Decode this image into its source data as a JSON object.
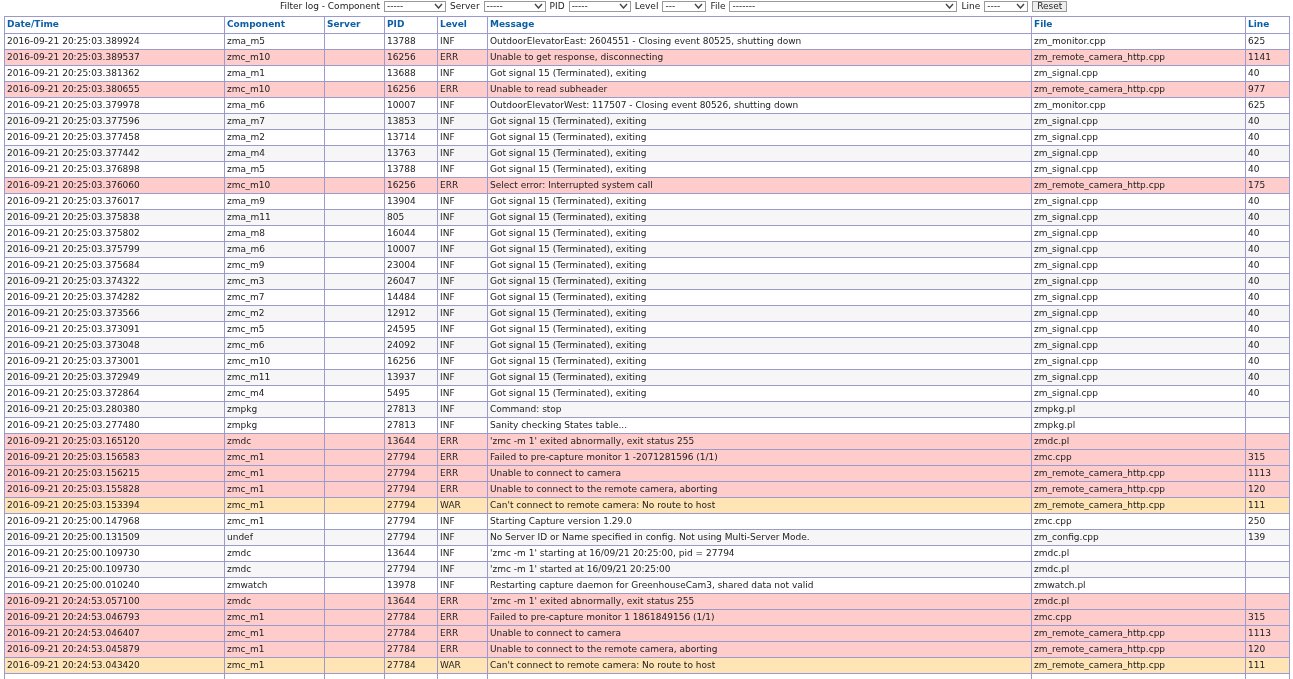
{
  "filters": [
    {
      "label": "Filter log - Component",
      "value": "-----"
    },
    {
      "label": "Server",
      "value": "-----"
    },
    {
      "label": "PID",
      "value": "-----"
    },
    {
      "label": "Level",
      "value": "---"
    },
    {
      "label": "File",
      "value": "-------"
    },
    {
      "label": "Line",
      "value": "----"
    }
  ],
  "reset_button": "Reset",
  "table": {
    "columns": [
      "Date/Time",
      "Component",
      "Server",
      "PID",
      "Level",
      "Message",
      "File",
      "Line"
    ],
    "rows": [
      {
        "datetime": "2016-09-21 20:25:03.389924",
        "component": "zma_m5",
        "pid": "13788",
        "level": "INF",
        "kind": "info",
        "message": "OutdoorElevatorEast: 2604551 - Closing event 80525, shutting down",
        "file": "zm_monitor.cpp",
        "line": "625"
      },
      {
        "datetime": "2016-09-21 20:25:03.389537",
        "component": "zmc_m10",
        "pid": "16256",
        "level": "ERR",
        "kind": "error",
        "message": "Unable to get response, disconnecting",
        "file": "zm_remote_camera_http.cpp",
        "line": "1141"
      },
      {
        "datetime": "2016-09-21 20:25:03.381362",
        "component": "zma_m1",
        "pid": "13688",
        "level": "INF",
        "kind": "info",
        "message": "Got signal 15 (Terminated), exiting",
        "file": "zm_signal.cpp",
        "line": "40"
      },
      {
        "datetime": "2016-09-21 20:25:03.380655",
        "component": "zmc_m10",
        "pid": "16256",
        "level": "ERR",
        "kind": "error",
        "message": "Unable to read subheader",
        "file": "zm_remote_camera_http.cpp",
        "line": "977"
      },
      {
        "datetime": "2016-09-21 20:25:03.379978",
        "component": "zma_m6",
        "pid": "10007",
        "level": "INF",
        "kind": "info",
        "message": "OutdoorElevatorWest: 117507 - Closing event 80526, shutting down",
        "file": "zm_monitor.cpp",
        "line": "625"
      },
      {
        "datetime": "2016-09-21 20:25:03.377596",
        "component": "zma_m7",
        "pid": "13853",
        "level": "INF",
        "kind": "info",
        "message": "Got signal 15 (Terminated), exiting",
        "file": "zm_signal.cpp",
        "line": "40"
      },
      {
        "datetime": "2016-09-21 20:25:03.377458",
        "component": "zma_m2",
        "pid": "13714",
        "level": "INF",
        "kind": "info",
        "message": "Got signal 15 (Terminated), exiting",
        "file": "zm_signal.cpp",
        "line": "40"
      },
      {
        "datetime": "2016-09-21 20:25:03.377442",
        "component": "zma_m4",
        "pid": "13763",
        "level": "INF",
        "kind": "info",
        "message": "Got signal 15 (Terminated), exiting",
        "file": "zm_signal.cpp",
        "line": "40"
      },
      {
        "datetime": "2016-09-21 20:25:03.376898",
        "component": "zma_m5",
        "pid": "13788",
        "level": "INF",
        "kind": "info",
        "message": "Got signal 15 (Terminated), exiting",
        "file": "zm_signal.cpp",
        "line": "40"
      },
      {
        "datetime": "2016-09-21 20:25:03.376060",
        "component": "zmc_m10",
        "pid": "16256",
        "level": "ERR",
        "kind": "error",
        "message": "Select error: Interrupted system call",
        "file": "zm_remote_camera_http.cpp",
        "line": "175"
      },
      {
        "datetime": "2016-09-21 20:25:03.376017",
        "component": "zma_m9",
        "pid": "13904",
        "level": "INF",
        "kind": "info",
        "message": "Got signal 15 (Terminated), exiting",
        "file": "zm_signal.cpp",
        "line": "40"
      },
      {
        "datetime": "2016-09-21 20:25:03.375838",
        "component": "zma_m11",
        "pid": "805",
        "level": "INF",
        "kind": "info",
        "message": "Got signal 15 (Terminated), exiting",
        "file": "zm_signal.cpp",
        "line": "40"
      },
      {
        "datetime": "2016-09-21 20:25:03.375802",
        "component": "zma_m8",
        "pid": "16044",
        "level": "INF",
        "kind": "info",
        "message": "Got signal 15 (Terminated), exiting",
        "file": "zm_signal.cpp",
        "line": "40"
      },
      {
        "datetime": "2016-09-21 20:25:03.375799",
        "component": "zma_m6",
        "pid": "10007",
        "level": "INF",
        "kind": "info",
        "message": "Got signal 15 (Terminated), exiting",
        "file": "zm_signal.cpp",
        "line": "40"
      },
      {
        "datetime": "2016-09-21 20:25:03.375684",
        "component": "zmc_m9",
        "pid": "23004",
        "level": "INF",
        "kind": "info",
        "message": "Got signal 15 (Terminated), exiting",
        "file": "zm_signal.cpp",
        "line": "40"
      },
      {
        "datetime": "2016-09-21 20:25:03.374322",
        "component": "zmc_m3",
        "pid": "26047",
        "level": "INF",
        "kind": "info",
        "message": "Got signal 15 (Terminated), exiting",
        "file": "zm_signal.cpp",
        "line": "40"
      },
      {
        "datetime": "2016-09-21 20:25:03.374282",
        "component": "zmc_m7",
        "pid": "14484",
        "level": "INF",
        "kind": "info",
        "message": "Got signal 15 (Terminated), exiting",
        "file": "zm_signal.cpp",
        "line": "40"
      },
      {
        "datetime": "2016-09-21 20:25:03.373566",
        "component": "zmc_m2",
        "pid": "12912",
        "level": "INF",
        "kind": "info",
        "message": "Got signal 15 (Terminated), exiting",
        "file": "zm_signal.cpp",
        "line": "40"
      },
      {
        "datetime": "2016-09-21 20:25:03.373091",
        "component": "zmc_m5",
        "pid": "24595",
        "level": "INF",
        "kind": "info",
        "message": "Got signal 15 (Terminated), exiting",
        "file": "zm_signal.cpp",
        "line": "40"
      },
      {
        "datetime": "2016-09-21 20:25:03.373048",
        "component": "zmc_m6",
        "pid": "24092",
        "level": "INF",
        "kind": "info",
        "message": "Got signal 15 (Terminated), exiting",
        "file": "zm_signal.cpp",
        "line": "40"
      },
      {
        "datetime": "2016-09-21 20:25:03.373001",
        "component": "zmc_m10",
        "pid": "16256",
        "level": "INF",
        "kind": "info",
        "message": "Got signal 15 (Terminated), exiting",
        "file": "zm_signal.cpp",
        "line": "40"
      },
      {
        "datetime": "2016-09-21 20:25:03.372949",
        "component": "zmc_m11",
        "pid": "13937",
        "level": "INF",
        "kind": "info",
        "message": "Got signal 15 (Terminated), exiting",
        "file": "zm_signal.cpp",
        "line": "40"
      },
      {
        "datetime": "2016-09-21 20:25:03.372864",
        "component": "zmc_m4",
        "pid": "5495",
        "level": "INF",
        "kind": "info",
        "message": "Got signal 15 (Terminated), exiting",
        "file": "zm_signal.cpp",
        "line": "40"
      },
      {
        "datetime": "2016-09-21 20:25:03.280380",
        "component": "zmpkg",
        "pid": "27813",
        "level": "INF",
        "kind": "info",
        "message": "Command: stop",
        "file": "zmpkg.pl"
      },
      {
        "datetime": "2016-09-21 20:25:03.277480",
        "component": "zmpkg",
        "pid": "27813",
        "level": "INF",
        "kind": "info",
        "message": "Sanity checking States table...",
        "file": "zmpkg.pl"
      },
      {
        "datetime": "2016-09-21 20:25:03.165120",
        "component": "zmdc",
        "pid": "13644",
        "level": "ERR",
        "kind": "error",
        "message": "'zmc -m 1' exited abnormally, exit status 255",
        "file": "zmdc.pl"
      },
      {
        "datetime": "2016-09-21 20:25:03.156583",
        "component": "zmc_m1",
        "pid": "27794",
        "level": "ERR",
        "kind": "error",
        "message": "Failed to pre-capture monitor 1 -2071281596 (1/1)",
        "file": "zmc.cpp",
        "line": "315"
      },
      {
        "datetime": "2016-09-21 20:25:03.156215",
        "component": "zmc_m1",
        "pid": "27794",
        "level": "ERR",
        "kind": "error",
        "message": "Unable to connect to camera",
        "file": "zm_remote_camera_http.cpp",
        "line": "1113"
      },
      {
        "datetime": "2016-09-21 20:25:03.155828",
        "component": "zmc_m1",
        "pid": "27794",
        "level": "ERR",
        "kind": "error",
        "message": "Unable to connect to the remote camera, aborting",
        "file": "zm_remote_camera_http.cpp",
        "line": "120"
      },
      {
        "datetime": "2016-09-21 20:25:03.153394",
        "component": "zmc_m1",
        "pid": "27794",
        "level": "WAR",
        "kind": "warning",
        "message": "Can't connect to remote camera: No route to host",
        "file": "zm_remote_camera_http.cpp",
        "line": "111"
      },
      {
        "datetime": "2016-09-21 20:25:00.147968",
        "component": "zmc_m1",
        "pid": "27794",
        "level": "INF",
        "kind": "info",
        "message": "Starting Capture version 1.29.0",
        "file": "zmc.cpp",
        "line": "250"
      },
      {
        "datetime": "2016-09-21 20:25:00.131509",
        "component": "undef",
        "pid": "27794",
        "level": "INF",
        "kind": "info",
        "message": "No Server ID or Name specified in config. Not using Multi-Server Mode.",
        "file": "zm_config.cpp",
        "line": "139"
      },
      {
        "datetime": "2016-09-21 20:25:00.109730",
        "component": "zmdc",
        "pid": "13644",
        "level": "INF",
        "kind": "info",
        "message": "'zmc -m 1' starting at 16/09/21 20:25:00, pid = 27794",
        "file": "zmdc.pl"
      },
      {
        "datetime": "2016-09-21 20:25:00.109730",
        "component": "zmdc",
        "pid": "27794",
        "level": "INF",
        "kind": "info",
        "message": "'zmc -m 1' started at 16/09/21 20:25:00",
        "file": "zmdc.pl"
      },
      {
        "datetime": "2016-09-21 20:25:00.010240",
        "component": "zmwatch",
        "pid": "13978",
        "level": "INF",
        "kind": "info",
        "message": "Restarting capture daemon for GreenhouseCam3, shared data not valid",
        "file": "zmwatch.pl"
      },
      {
        "datetime": "2016-09-21 20:24:53.057100",
        "component": "zmdc",
        "pid": "13644",
        "level": "ERR",
        "kind": "error",
        "message": "'zmc -m 1' exited abnormally, exit status 255",
        "file": "zmdc.pl"
      },
      {
        "datetime": "2016-09-21 20:24:53.046793",
        "component": "zmc_m1",
        "pid": "27784",
        "level": "ERR",
        "kind": "error",
        "message": "Failed to pre-capture monitor 1 1861849156 (1/1)",
        "file": "zmc.cpp",
        "line": "315"
      },
      {
        "datetime": "2016-09-21 20:24:53.046407",
        "component": "zmc_m1",
        "pid": "27784",
        "level": "ERR",
        "kind": "error",
        "message": "Unable to connect to camera",
        "file": "zm_remote_camera_http.cpp",
        "line": "1113"
      },
      {
        "datetime": "2016-09-21 20:24:53.045879",
        "component": "zmc_m1",
        "pid": "27784",
        "level": "ERR",
        "kind": "error",
        "message": "Unable to connect to the remote camera, aborting",
        "file": "zm_remote_camera_http.cpp",
        "line": "120"
      },
      {
        "datetime": "2016-09-21 20:24:53.043420",
        "component": "zmc_m1",
        "pid": "27784",
        "level": "WAR",
        "kind": "warning",
        "message": "Can't connect to remote camera: No route to host",
        "file": "zm_remote_camera_http.cpp",
        "line": "111"
      }
    ]
  }
}
